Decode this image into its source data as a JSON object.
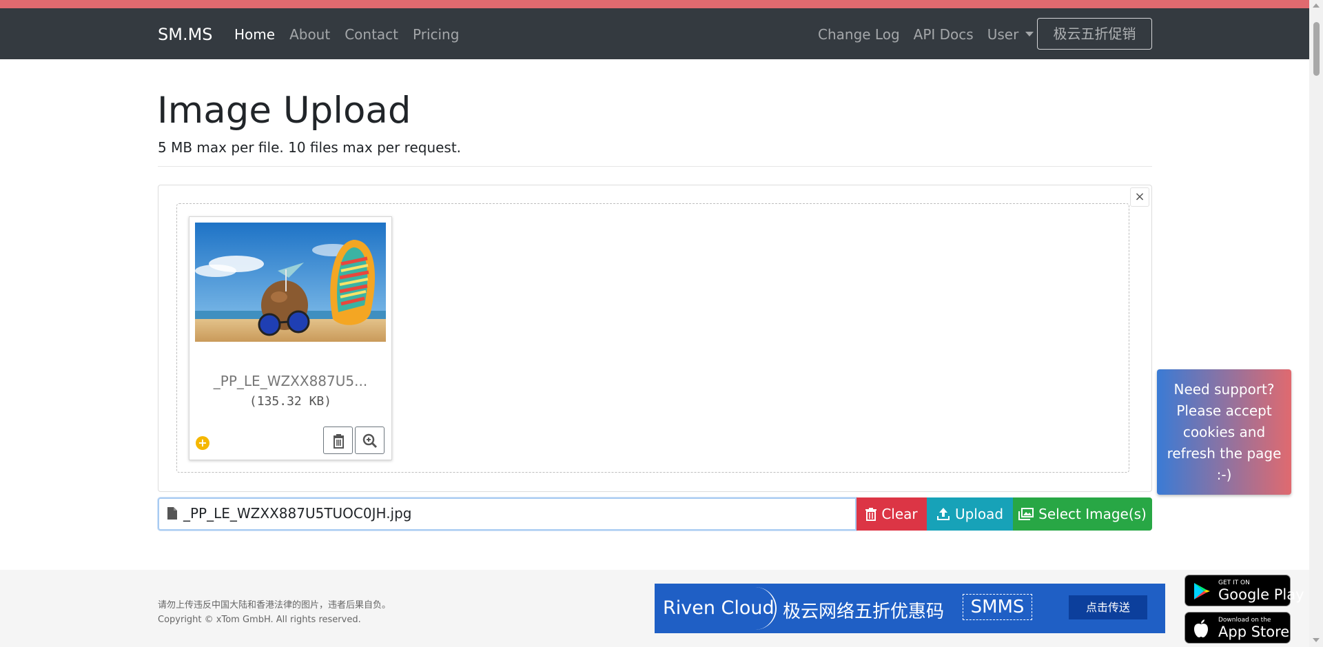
{
  "nav": {
    "brand": "SM.MS",
    "left_items": [
      "Home",
      "About",
      "Contact",
      "Pricing"
    ],
    "right_items": [
      "Change Log",
      "API Docs",
      "User"
    ],
    "promo_label": "极云五折促销"
  },
  "page": {
    "title": "Image Upload",
    "subtitle": "5 MB max per file. 10 files max per request."
  },
  "uploader": {
    "close_label": "×",
    "file": {
      "name_short": "_PP_LE_WZXX887U5...",
      "size": "(135.32 KB)",
      "full_name": "_PP_LE_WZXX887U5TUOC0JH.jpg"
    },
    "buttons": {
      "clear": "Clear",
      "upload": "Upload",
      "select": "Select Image(s)"
    }
  },
  "support": {
    "lines": [
      "Need support?",
      "Please accept",
      "cookies and",
      "refresh the page",
      ":-)"
    ]
  },
  "footer": {
    "notice": "请勿上传违反中国大陆和香港法律的图片，违者后果自负。",
    "copyright": "Copyright © xTom GmbH. All rights reserved.",
    "banner": {
      "brand": "Riven Cloud",
      "text": "极云网络五折优惠码",
      "code": "SMMS",
      "button": "点击传送"
    },
    "stores": {
      "google_small": "GET IT ON",
      "google_big": "Google Play",
      "apple_small": "Download on the",
      "apple_big": "App Store"
    }
  },
  "colors": {
    "navbar": "#343a40",
    "top_strip": "#e06a6f",
    "clear": "#dc3545",
    "upload": "#17a2b8",
    "select": "#28a745",
    "banner": "#1f5fc5"
  }
}
